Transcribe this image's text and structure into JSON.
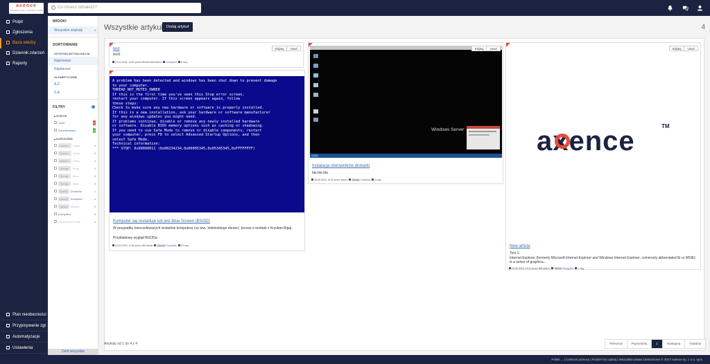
{
  "topbar": {
    "logo_text": "axence",
    "logo_subtext": "The fastest way to eliminate trouble",
    "search_placeholder": "Co chcesz odnaleźć?",
    "icons": [
      "bell-icon",
      "chat-icon",
      "user-icon"
    ]
  },
  "sidebar": {
    "items": [
      {
        "label": "Pulpit",
        "icon": "dashboard-icon",
        "active": false
      },
      {
        "label": "Zgłoszenia",
        "icon": "ticket-icon",
        "active": false
      },
      {
        "label": "Baza wiedzy",
        "icon": "book-icon",
        "active": true
      },
      {
        "label": "Dziennik zdarzeń",
        "icon": "log-icon",
        "active": false
      },
      {
        "label": "Raporty",
        "icon": "report-icon",
        "active": false
      }
    ],
    "bottom_items": [
      {
        "label": "Plan nieobecności",
        "icon": "calendar-icon"
      },
      {
        "label": "Przypisywanie zgł.",
        "icon": "assign-icon"
      },
      {
        "label": "Automatyzacje",
        "icon": "automation-icon"
      },
      {
        "label": "Ustawienia",
        "icon": "settings-icon"
      }
    ]
  },
  "left_panel": {
    "views_header": "WIDOKI",
    "views_item": "Wszystkie artykuły",
    "views_count": "4",
    "sort_header": "SORTOWANIE",
    "sort_recent_header": "OSTATNIA AKTUALIZACJA",
    "sort_newest": "Najnowsze",
    "sort_oldest": "Najstarsze",
    "sort_alpha_header": "ALFABETYCZNIE",
    "sort_az": "A-Z",
    "sort_za": "Z-A",
    "filters_header": "FILTRY",
    "status_header": "STATUS",
    "status_draft": "Szkic",
    "status_draft_count": "0",
    "status_published": "Opublikowany",
    "status_published_count": "1",
    "category_header": "KATEGORIA",
    "categories": [
      {
        "tag": "Dokum..",
        "label": "Faktu..",
        "count": "0",
        "dim": true
      },
      {
        "tag": "Dokum..",
        "label": "Zamó..",
        "count": "0",
        "dim": true
      },
      {
        "tag": "Dokum..",
        "label": "Zaliw..",
        "count": "0",
        "dim": true
      },
      {
        "tag": "Oprogr..",
        "label": "Progr..",
        "count": "0",
        "dim": true
      },
      {
        "tag": "Oprogr..",
        "label": "Serw..",
        "count": "0",
        "dim": true
      },
      {
        "tag": "Oprogr..",
        "label": "Syste..",
        "count": "0",
        "dim": true
      },
      {
        "tag": "Sprzęt",
        "label": "Drukarka",
        "count": "1",
        "dim": false
      },
      {
        "tag": "Sprzęt",
        "label": "Komputer",
        "count": "3",
        "dim": false
      },
      {
        "tag": "Sprzęt",
        "label": "Monitor",
        "count": "0",
        "dim": true
      },
      {
        "tag": "",
        "label": "Domyślna",
        "count": "3",
        "dim": false
      },
      {
        "tag": "",
        "label": "Zgłoszenia E-mail",
        "count": "0",
        "dim": true
      }
    ],
    "show_all": "Zwiń wszystkie"
  },
  "main": {
    "title": "Wszystkie artykuły",
    "add_button": "Dodaj artykuł",
    "total_count": "4",
    "edit_label": "Edytuj",
    "delete_label": "Usuń",
    "articles": [
      {
        "title": "test",
        "desc": "test1",
        "meta": "23.11.2016, 14:52 przez Michał Jeleniewicz",
        "category": "Domyślna",
        "tag": "",
        "views": "5 razy"
      },
      {
        "title": "Komputer się restartuje lub jest Blue Screen (BSOD)",
        "desc": "W przypadku nieoczekiwanych restartów komputera czy tzw. 'niebieskiego ekranu', proszę o kontakt z Krystian Bigaj.",
        "desc2": "Przykładowy wygląd BSODa:",
        "meta": "04.04.2016, 11:06 przez NM admin",
        "category": "Komputer",
        "tag": "Sprzęt",
        "views": "20 razy"
      },
      {
        "title": "Instalacja sterowników drukarki",
        "desc": "bla bla bla",
        "meta": "28.09.2016, 14:20 przez admin",
        "category": "Drukarka",
        "tag": "Sprzęt",
        "views": "6 razy"
      },
      {
        "title": "New article",
        "desc": "Test 1.",
        "desc2": "Internet Explorer (formerly Microsoft Internet Explorer and Windows Internet Explorer, commonly abbreviated IE or MSIE) is a series of graphica...",
        "meta": "25.05.2016, 14:04 przez NM admin",
        "category": "Komputer",
        "tag": "Sprzęt",
        "views": "1 razy"
      }
    ],
    "bsod_lines": [
      "A problem has been detected and windows has been shut down to prevent damage",
      "to your computer.",
      "",
      "THREAD_NOT_MUTEX_OWNER",
      "",
      "If this is the first time you've seen this Stop error screen,",
      "restart your computer. If this screen appears again, follow",
      "these steps:",
      "",
      "Check to make sure any new hardware or software is properly installed.",
      "If this is a new installation, ask your hardware or software manufacturer",
      "for any windows updates you might need.",
      "",
      "If problems continue, disable or remove any newly installed hardware",
      "or software. Disable BIOS memory options such as caching or shadowing.",
      "If you need to use Safe Mode to remove or disable components, restart",
      "your computer, press F8 to select Advanced Startup Options, and then",
      "select Safe Mode.",
      "",
      "Technical information:",
      "",
      "*** STOP: 0x00000011 (0x00234234,0x00005345,0x05345345,0xFFFFFFFF)"
    ],
    "windows_label": "Windows Server",
    "logo_article_text": "axence",
    "logo_tm": "TM"
  },
  "footer": {
    "summary": "Artykuły od 1 do 4 z 4",
    "pager": [
      "Pierwsza",
      "Poprzednia",
      "1",
      "Następna",
      "Ostatnia"
    ],
    "current_page": "1",
    "copyright": "Polski ⌄ | Centrum pomocy | Podziel się opinią | Wszystkie prawa zastrzeżone © 2017 Axence sp. z o.o. sp.k."
  }
}
